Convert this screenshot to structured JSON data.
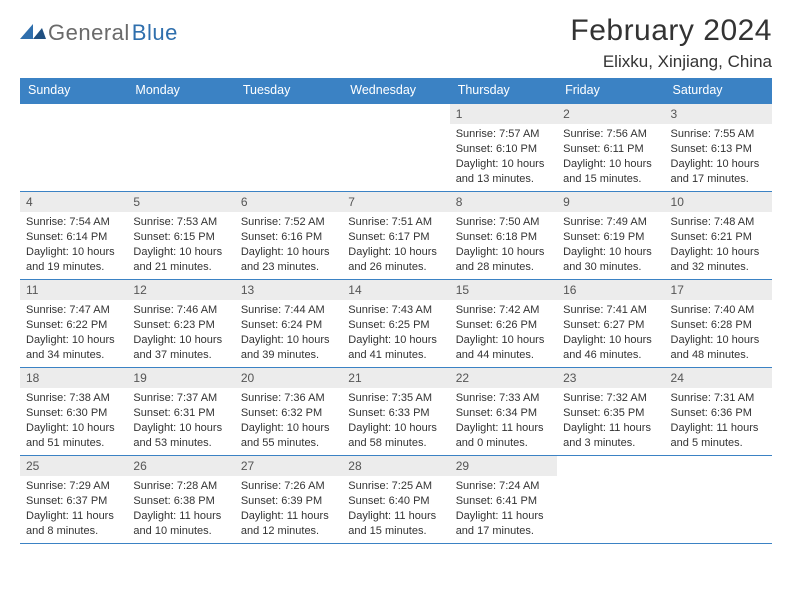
{
  "brand": {
    "name_part1": "General",
    "name_part2": "Blue"
  },
  "title": {
    "month": "February 2024",
    "location": "Elixku, Xinjiang, China"
  },
  "day_headers": [
    "Sunday",
    "Monday",
    "Tuesday",
    "Wednesday",
    "Thursday",
    "Friday",
    "Saturday"
  ],
  "weeks": [
    [
      null,
      null,
      null,
      null,
      {
        "n": "1",
        "sunrise": "Sunrise: 7:57 AM",
        "sunset": "Sunset: 6:10 PM",
        "daylight": "Daylight: 10 hours and 13 minutes."
      },
      {
        "n": "2",
        "sunrise": "Sunrise: 7:56 AM",
        "sunset": "Sunset: 6:11 PM",
        "daylight": "Daylight: 10 hours and 15 minutes."
      },
      {
        "n": "3",
        "sunrise": "Sunrise: 7:55 AM",
        "sunset": "Sunset: 6:13 PM",
        "daylight": "Daylight: 10 hours and 17 minutes."
      }
    ],
    [
      {
        "n": "4",
        "sunrise": "Sunrise: 7:54 AM",
        "sunset": "Sunset: 6:14 PM",
        "daylight": "Daylight: 10 hours and 19 minutes."
      },
      {
        "n": "5",
        "sunrise": "Sunrise: 7:53 AM",
        "sunset": "Sunset: 6:15 PM",
        "daylight": "Daylight: 10 hours and 21 minutes."
      },
      {
        "n": "6",
        "sunrise": "Sunrise: 7:52 AM",
        "sunset": "Sunset: 6:16 PM",
        "daylight": "Daylight: 10 hours and 23 minutes."
      },
      {
        "n": "7",
        "sunrise": "Sunrise: 7:51 AM",
        "sunset": "Sunset: 6:17 PM",
        "daylight": "Daylight: 10 hours and 26 minutes."
      },
      {
        "n": "8",
        "sunrise": "Sunrise: 7:50 AM",
        "sunset": "Sunset: 6:18 PM",
        "daylight": "Daylight: 10 hours and 28 minutes."
      },
      {
        "n": "9",
        "sunrise": "Sunrise: 7:49 AM",
        "sunset": "Sunset: 6:19 PM",
        "daylight": "Daylight: 10 hours and 30 minutes."
      },
      {
        "n": "10",
        "sunrise": "Sunrise: 7:48 AM",
        "sunset": "Sunset: 6:21 PM",
        "daylight": "Daylight: 10 hours and 32 minutes."
      }
    ],
    [
      {
        "n": "11",
        "sunrise": "Sunrise: 7:47 AM",
        "sunset": "Sunset: 6:22 PM",
        "daylight": "Daylight: 10 hours and 34 minutes."
      },
      {
        "n": "12",
        "sunrise": "Sunrise: 7:46 AM",
        "sunset": "Sunset: 6:23 PM",
        "daylight": "Daylight: 10 hours and 37 minutes."
      },
      {
        "n": "13",
        "sunrise": "Sunrise: 7:44 AM",
        "sunset": "Sunset: 6:24 PM",
        "daylight": "Daylight: 10 hours and 39 minutes."
      },
      {
        "n": "14",
        "sunrise": "Sunrise: 7:43 AM",
        "sunset": "Sunset: 6:25 PM",
        "daylight": "Daylight: 10 hours and 41 minutes."
      },
      {
        "n": "15",
        "sunrise": "Sunrise: 7:42 AM",
        "sunset": "Sunset: 6:26 PM",
        "daylight": "Daylight: 10 hours and 44 minutes."
      },
      {
        "n": "16",
        "sunrise": "Sunrise: 7:41 AM",
        "sunset": "Sunset: 6:27 PM",
        "daylight": "Daylight: 10 hours and 46 minutes."
      },
      {
        "n": "17",
        "sunrise": "Sunrise: 7:40 AM",
        "sunset": "Sunset: 6:28 PM",
        "daylight": "Daylight: 10 hours and 48 minutes."
      }
    ],
    [
      {
        "n": "18",
        "sunrise": "Sunrise: 7:38 AM",
        "sunset": "Sunset: 6:30 PM",
        "daylight": "Daylight: 10 hours and 51 minutes."
      },
      {
        "n": "19",
        "sunrise": "Sunrise: 7:37 AM",
        "sunset": "Sunset: 6:31 PM",
        "daylight": "Daylight: 10 hours and 53 minutes."
      },
      {
        "n": "20",
        "sunrise": "Sunrise: 7:36 AM",
        "sunset": "Sunset: 6:32 PM",
        "daylight": "Daylight: 10 hours and 55 minutes."
      },
      {
        "n": "21",
        "sunrise": "Sunrise: 7:35 AM",
        "sunset": "Sunset: 6:33 PM",
        "daylight": "Daylight: 10 hours and 58 minutes."
      },
      {
        "n": "22",
        "sunrise": "Sunrise: 7:33 AM",
        "sunset": "Sunset: 6:34 PM",
        "daylight": "Daylight: 11 hours and 0 minutes."
      },
      {
        "n": "23",
        "sunrise": "Sunrise: 7:32 AM",
        "sunset": "Sunset: 6:35 PM",
        "daylight": "Daylight: 11 hours and 3 minutes."
      },
      {
        "n": "24",
        "sunrise": "Sunrise: 7:31 AM",
        "sunset": "Sunset: 6:36 PM",
        "daylight": "Daylight: 11 hours and 5 minutes."
      }
    ],
    [
      {
        "n": "25",
        "sunrise": "Sunrise: 7:29 AM",
        "sunset": "Sunset: 6:37 PM",
        "daylight": "Daylight: 11 hours and 8 minutes."
      },
      {
        "n": "26",
        "sunrise": "Sunrise: 7:28 AM",
        "sunset": "Sunset: 6:38 PM",
        "daylight": "Daylight: 11 hours and 10 minutes."
      },
      {
        "n": "27",
        "sunrise": "Sunrise: 7:26 AM",
        "sunset": "Sunset: 6:39 PM",
        "daylight": "Daylight: 11 hours and 12 minutes."
      },
      {
        "n": "28",
        "sunrise": "Sunrise: 7:25 AM",
        "sunset": "Sunset: 6:40 PM",
        "daylight": "Daylight: 11 hours and 15 minutes."
      },
      {
        "n": "29",
        "sunrise": "Sunrise: 7:24 AM",
        "sunset": "Sunset: 6:41 PM",
        "daylight": "Daylight: 11 hours and 17 minutes."
      },
      null,
      null
    ]
  ]
}
